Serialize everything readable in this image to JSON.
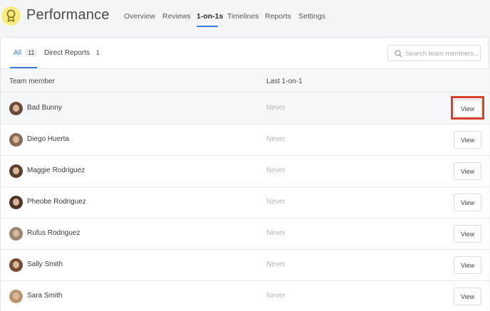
{
  "app": {
    "title": "Performance"
  },
  "nav": [
    {
      "label": "Overview"
    },
    {
      "label": "Reviews"
    },
    {
      "label": "1-on-1s",
      "active": true
    },
    {
      "label": "Timelines"
    },
    {
      "label": "Reports"
    },
    {
      "label": "Settings"
    }
  ],
  "tabs": [
    {
      "label": "All",
      "count": "11",
      "active": true
    },
    {
      "label": "Direct Reports",
      "count": "1"
    }
  ],
  "search": {
    "placeholder": "Search team members..."
  },
  "table": {
    "headers": {
      "member": "Team member",
      "last": "Last 1-on-1"
    },
    "rows": [
      {
        "name": "Bad Bunny",
        "last": "Never",
        "action": "View",
        "avatar_color": "#6b4a3a"
      },
      {
        "name": "Diego Huerta",
        "last": "Never",
        "action": "View",
        "avatar_color": "#8a6b55"
      },
      {
        "name": "Maggie Rodriguez",
        "last": "Never",
        "action": "View",
        "avatar_color": "#5a3e2e"
      },
      {
        "name": "Pheobe Rodriguez",
        "last": "Never",
        "action": "View",
        "avatar_color": "#4d3528"
      },
      {
        "name": "Rufus Rodriguez",
        "last": "Never",
        "action": "View",
        "avatar_color": "#9a8470"
      },
      {
        "name": "Sally Smith",
        "last": "Never",
        "action": "View",
        "avatar_color": "#7a4a32"
      },
      {
        "name": "Sara Smith",
        "last": "Never",
        "action": "View",
        "avatar_color": "#b8956e"
      }
    ]
  },
  "colors": {
    "accent": "#3a7bd5",
    "highlight": "#d9402b",
    "logo_bg": "#f7ec83"
  }
}
